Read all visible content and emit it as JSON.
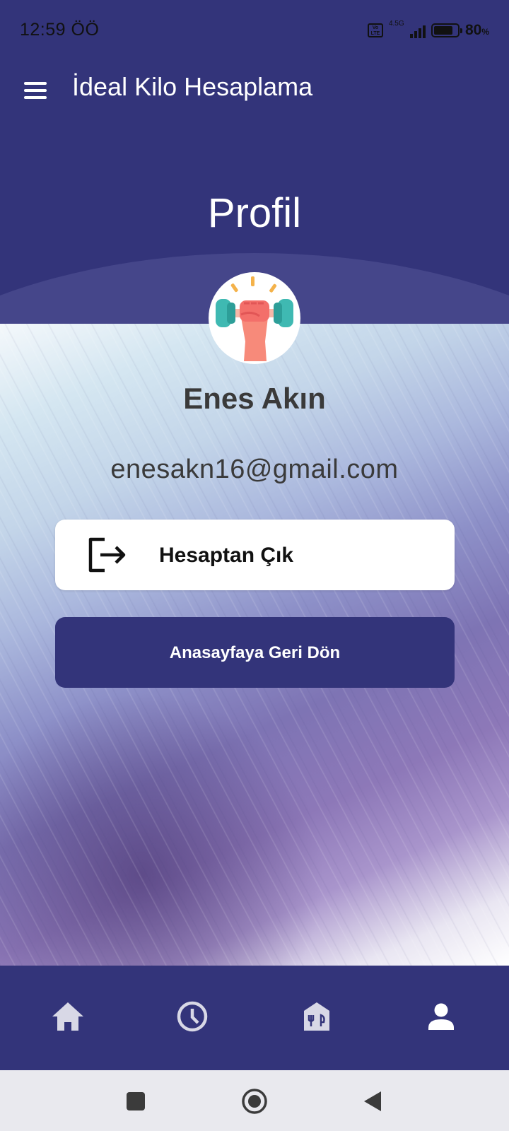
{
  "status_bar": {
    "time": "12:59 ÖÖ",
    "volte": "Vo LTE",
    "network": "4.5G",
    "battery_level": 0.8,
    "battery_text": "80",
    "battery_unit": "%"
  },
  "app_bar": {
    "title": "İdeal Kilo Hesaplama",
    "menu_icon": "hamburger-menu-icon"
  },
  "header": {
    "title": "Profil"
  },
  "profile": {
    "avatar_icon": "fist-dumbbell-icon",
    "name": "Enes Akın",
    "email": "enesakn16@gmail.com"
  },
  "actions": {
    "logout_label": "Hesaptan Çık",
    "logout_icon": "logout-icon",
    "home_label": "Anasayfaya Geri Dön"
  },
  "bottom_nav": {
    "items": [
      {
        "icon": "home-icon",
        "active": false
      },
      {
        "icon": "clock-icon",
        "active": false
      },
      {
        "icon": "restaurant-icon",
        "active": false
      },
      {
        "icon": "person-icon",
        "active": true
      }
    ],
    "colors": {
      "active": "#ffffff",
      "inactive": "#d8d8e6"
    }
  },
  "system_nav": {
    "items": [
      "recents-square-icon",
      "home-circle-icon",
      "back-triangle-icon"
    ]
  },
  "colors": {
    "primary": "#33347a",
    "text_dark": "#3a3a3a",
    "button_light": "#ffffff"
  }
}
